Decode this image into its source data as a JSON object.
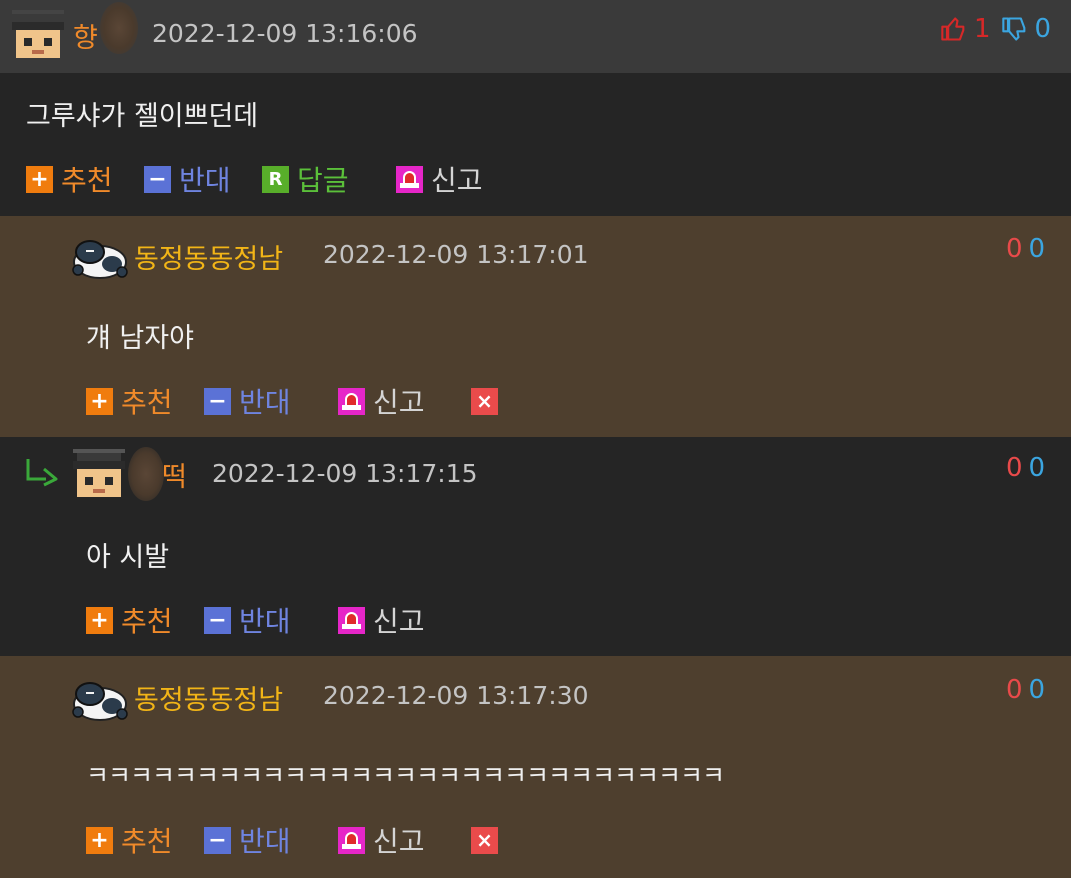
{
  "comments": [
    {
      "nickname": "향",
      "date": "2022-12-09 13:16:06",
      "body": "그루샤가 젤이쁘던데",
      "up": "1",
      "down": "0",
      "actions": {
        "recommend": "추천",
        "oppose": "반대",
        "reply": "답글",
        "report": "신고"
      },
      "reply_icon": "R"
    },
    {
      "nickname": "동정동동정남",
      "date": "2022-12-09 13:17:01",
      "body": "걔 남자야",
      "up": "0",
      "down": "0",
      "actions": {
        "recommend": "추천",
        "oppose": "반대",
        "report": "신고"
      }
    },
    {
      "nickname": "떡",
      "date": "2022-12-09 13:17:15",
      "body": "아 시발",
      "up": "0",
      "down": "0",
      "actions": {
        "recommend": "추천",
        "oppose": "반대",
        "report": "신고"
      }
    },
    {
      "nickname": "동정동동정남",
      "date": "2022-12-09 13:17:30",
      "body": "ㅋㅋㅋㅋㅋㅋㅋㅋㅋㅋㅋㅋㅋㅋㅋㅋㅋㅋㅋㅋㅋㅋㅋㅋㅋㅋㅋㅋㅋ",
      "up": "0",
      "down": "0",
      "actions": {
        "recommend": "추천",
        "oppose": "반대",
        "report": "신고"
      }
    }
  ],
  "icons": {
    "plus": "+",
    "minus": "−",
    "delete": "×",
    "reply_arrow": "reply-arrow-icon",
    "thumbs_up": "thumbs-up-icon",
    "thumbs_down": "thumbs-down-icon"
  },
  "colors": {
    "nick_orange": "#f08a2a",
    "nick_yellow": "#f2b517",
    "up_red": "#e84a4a",
    "down_blue": "#3ba5e0",
    "brown_bg": "#4e3f2e",
    "dark_bg": "#252525"
  }
}
